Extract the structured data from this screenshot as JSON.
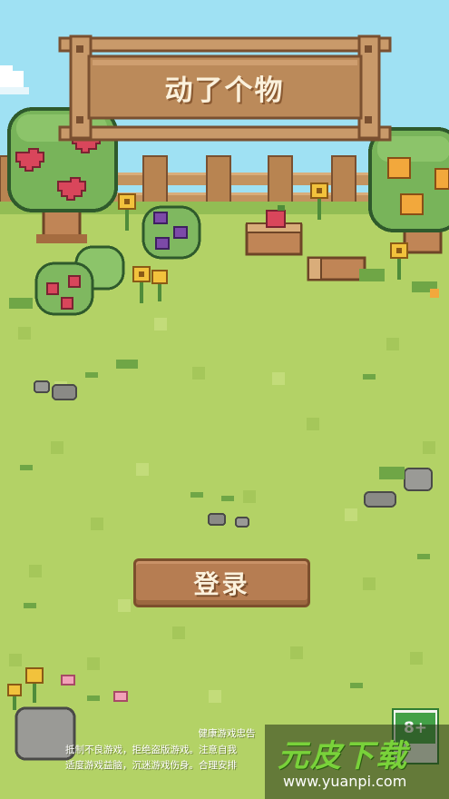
{
  "game": {
    "title": "动了个物",
    "login_button": "登录"
  },
  "health_notice": {
    "title": "健康游戏忠告",
    "line1": "抵制不良游戏，拒绝盗版游戏。注意自我",
    "line2": "适度游戏益脑，沉迷游戏伤身。合理安排"
  },
  "age_rating": {
    "label": "8+"
  },
  "watermark": {
    "brand": "元皮下载",
    "url": "www.yuanpi.com"
  },
  "colors": {
    "sky": "#9fe1f3",
    "grass": "#b3d266",
    "wood": "#c99a6a",
    "button": "#b67d52",
    "text_light": "#fbf1dc"
  },
  "icons": [
    "apple-tree-icon",
    "orange-tree-icon",
    "grape-bush-icon",
    "sunflower-icon",
    "tree-stump-icon",
    "log-icon",
    "rock-icon",
    "cloud-icon"
  ]
}
